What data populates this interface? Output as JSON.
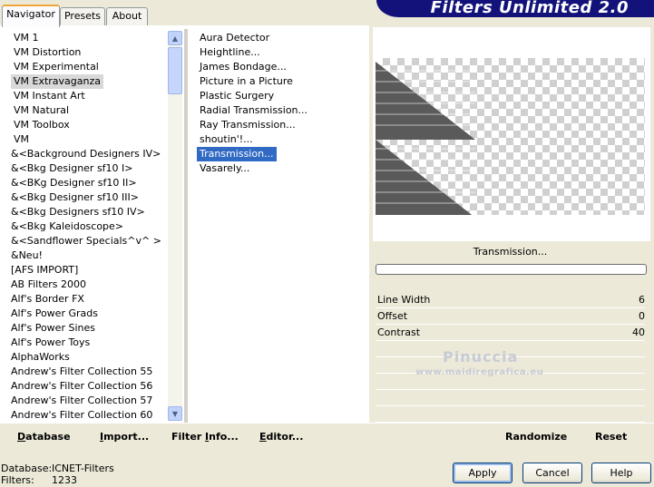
{
  "tabs": [
    {
      "label": "Navigator"
    },
    {
      "label": "Presets"
    },
    {
      "label": "About"
    }
  ],
  "banner": {
    "title": "Filters Unlimited 2.0"
  },
  "categories": [
    "VM 1",
    "VM Distortion",
    "VM Experimental",
    "VM Extravaganza",
    "VM Instant Art",
    "VM Natural",
    "VM Toolbox",
    "VM",
    "&<Background Designers IV>",
    "&<Bkg Designer sf10 I>",
    "&<BKg Designer sf10 II>",
    "&<Bkg Designer sf10 III>",
    "&<Bkg Designers sf10 IV>",
    "&<Bkg Kaleidoscope>",
    "&<Sandflower Specials^v^ >",
    "&Neu!",
    "[AFS IMPORT]",
    "AB Filters 2000",
    "Alf's Border FX",
    "Alf's Power Grads",
    "Alf's Power Sines",
    "Alf's Power Toys",
    "AlphaWorks",
    "Andrew's Filter Collection 55",
    "Andrew's Filter Collection 56",
    "Andrew's Filter Collection 57",
    "Andrew's Filter Collection 60"
  ],
  "filters": [
    " Aura Detector",
    "Heightline...",
    "James Bondage...",
    "Picture in a Picture",
    "Plastic Surgery",
    "Radial Transmission...",
    "Ray Transmission...",
    "shoutin'!...",
    "Transmission...",
    "Vasarely..."
  ],
  "selected_category": "VM Extravaganza",
  "selected_filter": "Transmission...",
  "preview": {
    "filter_name": "Transmission...",
    "watermark": "Pinuccia",
    "watermark_url": "www.maidiregrafica.eu"
  },
  "params": [
    {
      "label": "Line Width",
      "value": "6"
    },
    {
      "label": "Offset",
      "value": "0"
    },
    {
      "label": "Contrast",
      "value": "40"
    }
  ],
  "bottom_bar": {
    "database_prefix": "",
    "database_u": "D",
    "database_rest": "atabase",
    "import_prefix": "",
    "import_u": "I",
    "import_rest": "mport...",
    "filterinfo_prefix": "Filter ",
    "filterinfo_u": "I",
    "filterinfo_rest": "nfo...",
    "editor_prefix": "",
    "editor_u": "E",
    "editor_rest": "ditor...",
    "randomize": "Randomize",
    "reset": "Reset"
  },
  "status": {
    "database_label": "Database:",
    "database_value": "ICNET-Filters",
    "filters_label": "Filters:",
    "filters_value": "1233"
  },
  "buttons": {
    "apply": "Apply",
    "cancel": "Cancel",
    "help": "Help"
  }
}
